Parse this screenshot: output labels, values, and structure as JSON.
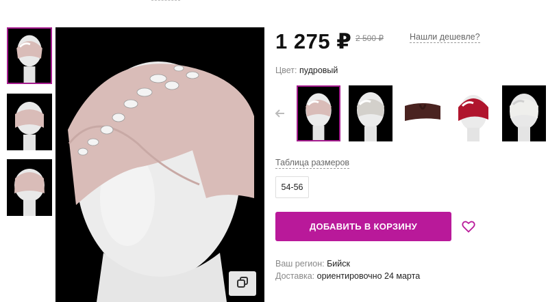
{
  "product": {
    "price": "1 275 ₽",
    "old_price": "2 500 ₽",
    "cheaper_link": "Нашли дешевле?",
    "color_label": "Цвет:",
    "color_value": "пудровый",
    "size_table_link": "Таблица размеров",
    "sizes": [
      "54-56"
    ],
    "add_to_cart": "Добавить в корзину"
  },
  "gallery": {
    "thumbnails": [
      "front-view",
      "side-view",
      "back-view"
    ],
    "selected_thumbnail": 0
  },
  "color_swatches": {
    "items": [
      "powder",
      "light-grey",
      "brown",
      "red",
      "white"
    ],
    "selected": 0
  },
  "delivery": {
    "region_label": "Ваш регион:",
    "region_value": "Бийск",
    "delivery_label": "Доставка:",
    "delivery_value": "ориентировочно 24 марта"
  },
  "colors": {
    "accent": "#b9199a",
    "border_selected": "#a51b8e",
    "product_pink": "#d9bcb8",
    "swatch_grey": "#d3d0cb",
    "swatch_brown": "#4a2320",
    "swatch_red": "#b0152d",
    "swatch_white": "#efefec"
  },
  "icons": {
    "zoom": "copy-icon",
    "arrow": "arrow-left-icon",
    "wishlist": "heart-icon"
  }
}
